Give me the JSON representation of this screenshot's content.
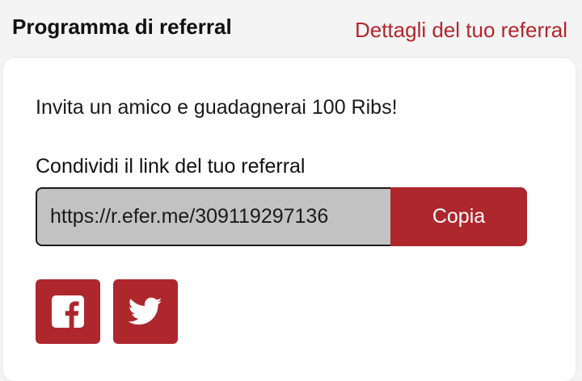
{
  "header": {
    "title": "Programma di referral",
    "details_link": "Dettagli del tuo referral"
  },
  "card": {
    "invite_text": "Invita un amico e guadagnerai 100 Ribs!",
    "share_label": "Condividi il link del tuo referral",
    "referral_link": "https://r.efer.me/309119297136",
    "copy_label": "Copia"
  },
  "social": [
    {
      "icon": "facebook-icon"
    },
    {
      "icon": "twitter-icon"
    }
  ],
  "colors": {
    "accent": "#ad272d",
    "link": "#b3262c",
    "input_bg": "#c2c2c2"
  }
}
